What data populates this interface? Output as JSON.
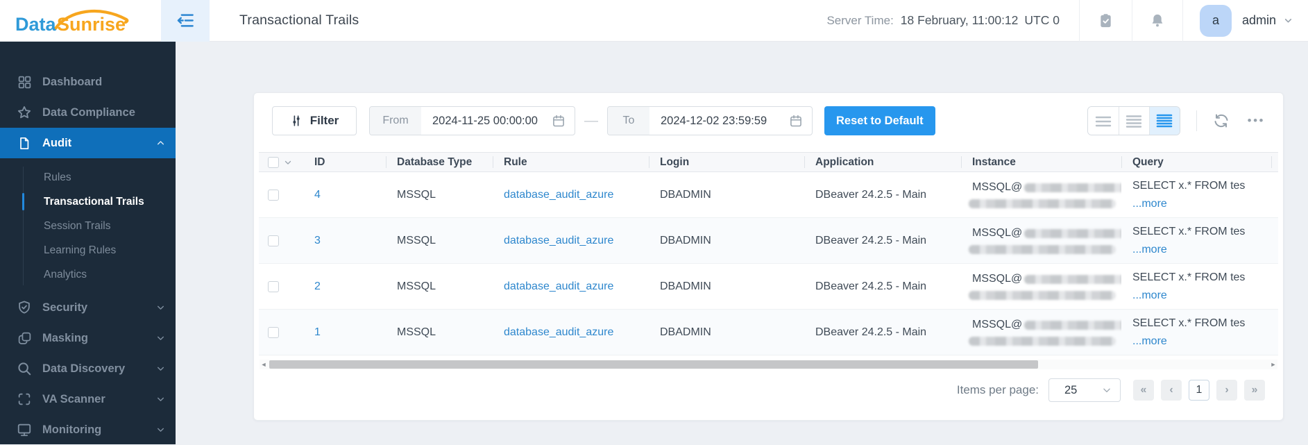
{
  "colors": {
    "accent": "#0f6fba",
    "link": "#2e87cd",
    "reset_button": "#2797ee",
    "sidebar_bg": "#1c2b3a",
    "logo_blue": "#2f9ad8",
    "logo_orange": "#f7a61e"
  },
  "brand": {
    "word1": "Data",
    "word2": "Sunrise"
  },
  "topbar": {
    "title": "Transactional Trails",
    "server_time": {
      "label": "Server Time:",
      "value": "18 February, 11:00:12",
      "utc": "UTC 0"
    },
    "user": {
      "initial": "a",
      "name": "admin"
    }
  },
  "sidebar": {
    "items": [
      {
        "label": "Dashboard",
        "icon": "grid-icon"
      },
      {
        "label": "Data Compliance",
        "icon": "star-icon"
      },
      {
        "label": "Audit",
        "icon": "file-icon",
        "active": true,
        "chevron": "up"
      },
      {
        "label": "Rules",
        "sub": true
      },
      {
        "label": "Transactional Trails",
        "sub": true,
        "active": true
      },
      {
        "label": "Session Trails",
        "sub": true
      },
      {
        "label": "Learning Rules",
        "sub": true
      },
      {
        "label": "Analytics",
        "sub": true
      },
      {
        "label": "Security",
        "icon": "shield-icon",
        "chevron": "down"
      },
      {
        "label": "Masking",
        "icon": "mask-icon",
        "chevron": "down"
      },
      {
        "label": "Data Discovery",
        "icon": "search-icon",
        "chevron": "down"
      },
      {
        "label": "VA Scanner",
        "icon": "scanner-icon",
        "chevron": "down"
      },
      {
        "label": "Monitoring",
        "icon": "monitor-icon",
        "chevron": "down"
      }
    ]
  },
  "toolbar": {
    "filter_label": "Filter",
    "from_label": "From",
    "from_value": "2024-11-25 00:00:00",
    "range_dash": "—",
    "to_label": "To",
    "to_value": "2024-12-02 23:59:59",
    "reset_label": "Reset to Default",
    "more_glyph": "•••"
  },
  "table": {
    "columns": [
      "ID",
      "Database Type",
      "Rule",
      "Login",
      "Application",
      "Instance",
      "Query"
    ],
    "rows": [
      {
        "id": "4",
        "db": "MSSQL",
        "rule": "database_audit_azure",
        "login": "DBADMIN",
        "app": "DBeaver 24.2.5 - Main",
        "instance_prefix": "MSSQL@",
        "query": "SELECT x.* FROM tes",
        "more": "...more"
      },
      {
        "id": "3",
        "db": "MSSQL",
        "rule": "database_audit_azure",
        "login": "DBADMIN",
        "app": "DBeaver 24.2.5 - Main",
        "instance_prefix": "MSSQL@",
        "query": "SELECT x.* FROM tes",
        "more": "...more"
      },
      {
        "id": "2",
        "db": "MSSQL",
        "rule": "database_audit_azure",
        "login": "DBADMIN",
        "app": "DBeaver 24.2.5 - Main",
        "instance_prefix": "MSSQL@",
        "query": "SELECT x.* FROM tes",
        "more": "...more"
      },
      {
        "id": "1",
        "db": "MSSQL",
        "rule": "database_audit_azure",
        "login": "DBADMIN",
        "app": "DBeaver 24.2.5 - Main",
        "instance_prefix": "MSSQL@",
        "query": "SELECT x.* FROM tes",
        "more": "...more"
      }
    ]
  },
  "pagination": {
    "items_label": "Items per page:",
    "page_size": "25",
    "first_glyph": "«",
    "prev_glyph": "‹",
    "page": "1",
    "next_glyph": "›",
    "last_glyph": "»"
  }
}
